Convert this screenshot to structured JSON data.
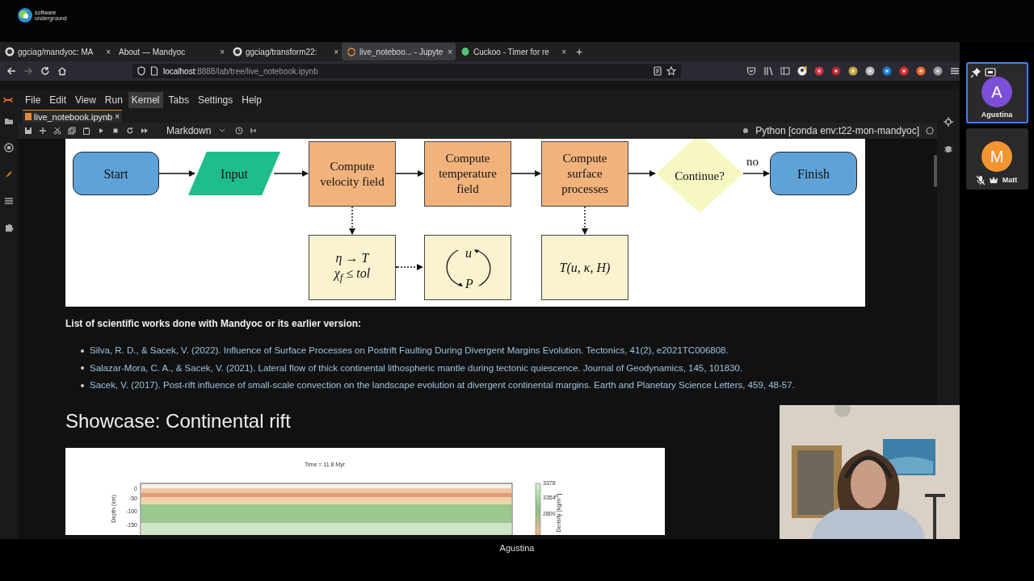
{
  "logo": {
    "lines": [
      "software",
      "underground"
    ]
  },
  "browser": {
    "tabs": [
      {
        "label": "ggciag/mandyoc: MA",
        "kind": "github",
        "close": "×",
        "selected": false
      },
      {
        "label": "About — Mandyoc",
        "kind": "plain",
        "close": "×",
        "selected": false
      },
      {
        "label": "ggciag/transform22:",
        "kind": "github",
        "close": "×",
        "selected": false
      },
      {
        "label": "live_noteboo... - Jupyte",
        "kind": "loading",
        "close": "×",
        "selected": true
      },
      {
        "label": "Cuckoo - Timer for re",
        "kind": "cuckoo",
        "close": "×",
        "selected": false
      }
    ],
    "new_tab": "+",
    "address": {
      "host": "localhost",
      "path": ":8888/lab/tree/live_notebook.ipynb"
    }
  },
  "jupyter": {
    "menu": [
      {
        "label": "File",
        "selected": false
      },
      {
        "label": "Edit",
        "selected": false
      },
      {
        "label": "View",
        "selected": false
      },
      {
        "label": "Run",
        "selected": false
      },
      {
        "label": "Kernel",
        "selected": true
      },
      {
        "label": "Tabs",
        "selected": false
      },
      {
        "label": "Settings",
        "selected": false
      },
      {
        "label": "Help",
        "selected": false
      }
    ],
    "document_tab": {
      "label": "live_notebook.ipynb",
      "close": "×"
    },
    "toolbar": {
      "cell_type": "Markdown",
      "kernel": "Python [conda env:t22-mon-mandyoc]"
    }
  },
  "flowchart": {
    "nodes": [
      {
        "kind": "terminal",
        "text": "Start"
      },
      {
        "kind": "io",
        "text": "Input"
      },
      {
        "kind": "process",
        "text": "Compute velocity field"
      },
      {
        "kind": "process",
        "text": "Compute temperature field"
      },
      {
        "kind": "process",
        "text": "Compute surface processes"
      },
      {
        "kind": "decision",
        "text": "Continue?"
      },
      {
        "kind": "terminal",
        "text": "Finish"
      }
    ],
    "edge_label": "no",
    "subnodes": [
      {
        "kind": "math",
        "lines": [
          "η → T",
          "χ$_{f}$ ≤ tol"
        ]
      },
      {
        "kind": "cycle",
        "lines": [
          "u",
          "P"
        ]
      },
      {
        "kind": "math",
        "lines": [
          "T(u, κ, H)"
        ]
      }
    ]
  },
  "references": {
    "heading": "List of scientific works done with Mandyoc or its earlier version:",
    "items": [
      "Silva, R. D., & Sacek, V. (2022). Influence of Surface Processes on Postrift Faulting During Divergent Margins Evolution. Tectonics, 41(2), e2021TC006808.",
      "Salazar-Mora, C. A., & Sacek, V. (2021). Lateral flow of thick continental lithospheric mantle during tectonic quiescence. Journal of Geodynamics, 145, 101830.",
      "Sacek, V. (2017). Post-rift influence of small-scale convection on the landscape evolution at divergent continental margins. Earth and Planetary Science Letters, 459, 48-57."
    ]
  },
  "section_heading": "Showcase: Continental rift",
  "figure": {
    "title": "Time = 11.8 Myr",
    "ylabel": "Depth (km)",
    "yticks": [
      "0",
      "-50",
      "-100",
      "-150"
    ],
    "colorbar_ticks": [
      "3378",
      "3354",
      "2800"
    ],
    "colorbar_label": "Density [kg/m$^{3}$]"
  },
  "call": {
    "speaker": "Agustina",
    "participants": [
      {
        "initial": "A",
        "name": "Agustina",
        "color": "#7c4fd8",
        "selected": true,
        "kind": "pinned"
      },
      {
        "initial": "M",
        "name": "Matt",
        "color": "#f29430",
        "selected": false,
        "kind": "muted"
      }
    ]
  }
}
